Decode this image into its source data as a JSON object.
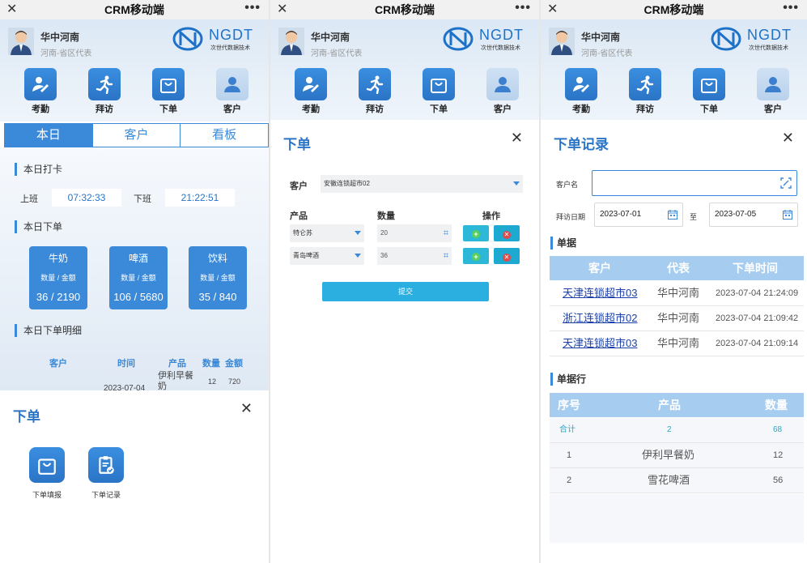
{
  "window": {
    "title": "CRM移动端",
    "close_glyph": "✕",
    "more_glyph": "•••"
  },
  "user": {
    "name": "华中河南",
    "role": "河南-省区代表"
  },
  "logo": {
    "text": "NGDT",
    "subtitle": "次世代数据技术"
  },
  "menu": [
    {
      "label": "考勤",
      "icon": "attendance-pen-icon"
    },
    {
      "label": "拜访",
      "icon": "running-person-icon"
    },
    {
      "label": "下单",
      "icon": "shopping-bag-icon"
    },
    {
      "label": "客户",
      "icon": "person-icon"
    }
  ],
  "panel1": {
    "tabs": [
      "本日",
      "客户",
      "看板"
    ],
    "checkin_title": "本日打卡",
    "clock_in_label": "上班",
    "clock_in": "07:32:33",
    "clock_out_label": "下班",
    "clock_out": "21:22:51",
    "orders_title": "本日下单",
    "cards": [
      {
        "name": "牛奶",
        "sub": "数量 / 金额",
        "qty": "36",
        "amount": "2190"
      },
      {
        "name": "啤酒",
        "sub": "数量 / 金额",
        "qty": "106",
        "amount": "5680"
      },
      {
        "name": "饮料",
        "sub": "数量 / 金额",
        "qty": "35",
        "amount": "840"
      }
    ],
    "detail_title": "本日下单明细",
    "detail_headers": [
      "客户",
      "时间",
      "产品",
      "数量",
      "金额"
    ],
    "detail_row": {
      "time": "2023-07-04",
      "product": "伊利早餐奶",
      "qty": "12",
      "amount": "720"
    },
    "sheet": {
      "title": "下单",
      "buttons": [
        {
          "label": "下单填报",
          "icon": "shopping-bag-icon"
        },
        {
          "label": "下单记录",
          "icon": "clipboard-check-icon"
        }
      ]
    }
  },
  "panel2": {
    "title": "下单",
    "customer_label": "客户",
    "customer_value": "安徽连锁超市02",
    "product_header": "产品",
    "qty_header": "数量",
    "action_header": "操作",
    "rows": [
      {
        "product": "特仑苏",
        "qty": "20"
      },
      {
        "product": "青岛啤酒",
        "qty": "36"
      }
    ],
    "add_glyph": "+",
    "delete_glyph": "✕",
    "submit_label": "提交"
  },
  "panel3": {
    "title": "下单记录",
    "customer_name_label": "客户名",
    "visit_date_label": "拜访日期",
    "date_from": "2023-07-01",
    "to_label": "至",
    "date_to": "2023-07-05",
    "orders_section": "单据",
    "orders_headers": [
      "客户",
      "代表",
      "下单时间"
    ],
    "orders": [
      {
        "customer": "天津连锁超市03",
        "rep": "华中河南",
        "time": "2023-07-04 21:24:09"
      },
      {
        "customer": "浙江连锁超市02",
        "rep": "华中河南",
        "time": "2023-07-04 21:09:42"
      },
      {
        "customer": "天津连锁超市03",
        "rep": "华中河南",
        "time": "2023-07-04 21:09:14"
      }
    ],
    "lines_section": "单据行",
    "lines_headers": [
      "序号",
      "产品",
      "数量"
    ],
    "total": {
      "label": "合计",
      "count": "2",
      "qty": "68"
    },
    "lines": [
      {
        "no": "1",
        "product": "伊利早餐奶",
        "qty": "12"
      },
      {
        "no": "2",
        "product": "雪花啤酒",
        "qty": "56"
      }
    ]
  },
  "colors": {
    "accent": "#3b8ad9",
    "brand": "#1d72c8",
    "link": "#1a3fa8",
    "header_bg": "#a6cdef"
  }
}
